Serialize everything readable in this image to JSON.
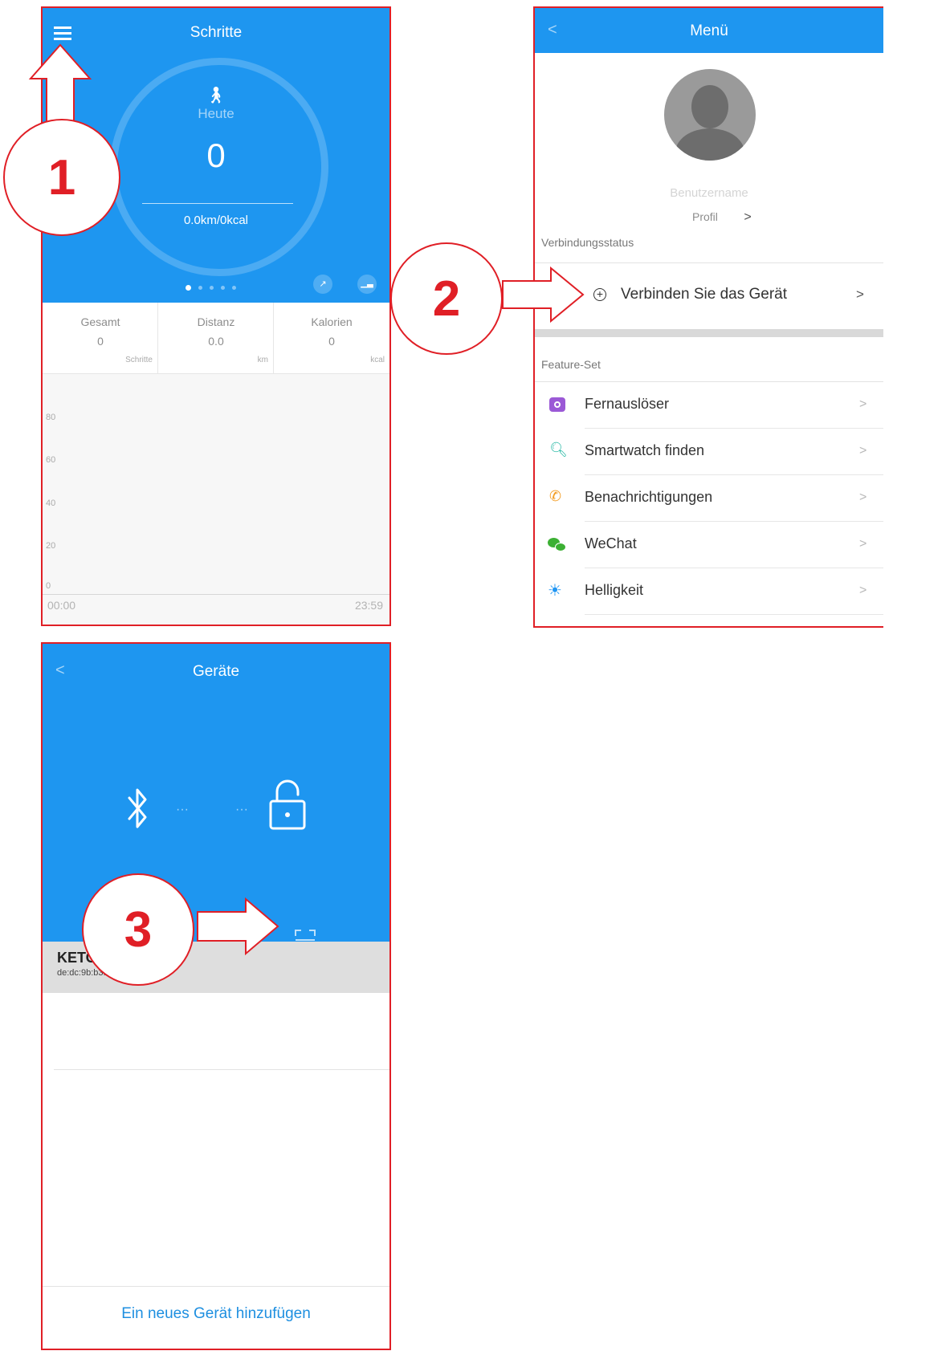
{
  "screen1": {
    "title": "Schritte",
    "today_label": "Heute",
    "steps": "0",
    "dist_kcal": "0.0km/0kcal",
    "stats": [
      {
        "label": "Gesamt",
        "value": "0",
        "unit": "Schritte"
      },
      {
        "label": "Distanz",
        "value": "0.0",
        "unit": "km"
      },
      {
        "label": "Kalorien",
        "value": "0",
        "unit": "kcal"
      }
    ],
    "chart_data": {
      "type": "bar",
      "x": [
        "00:00",
        "23:59"
      ],
      "xtick_labels": [
        "00:00",
        "23:59"
      ],
      "ytick_labels": [
        "80",
        "60",
        "40",
        "20",
        "0"
      ],
      "ylim": [
        0,
        80
      ],
      "values": []
    }
  },
  "screen2": {
    "back": "<",
    "title": "Menü",
    "username": "Benutzername",
    "profile": "Profil",
    "profile_chevron": ">",
    "connection_status": "Verbindungsstatus",
    "connect_device": "Verbinden Sie das Gerät",
    "connect_chevron": ">",
    "feature_set": "Feature-Set",
    "features": [
      {
        "label": "Fernauslöser",
        "icon": "camera-icon",
        "color": "#9b59d6"
      },
      {
        "label": "Smartwatch finden",
        "icon": "find-watch-icon",
        "color": "#23b7a3"
      },
      {
        "label": "Benachrichtigungen",
        "icon": "notification-phone-icon",
        "color": "#f39c22"
      },
      {
        "label": "WeChat",
        "icon": "wechat-icon",
        "color": "#3cb034"
      },
      {
        "label": "Helligkeit",
        "icon": "brightness-icon",
        "color": "#2196f3"
      }
    ],
    "feature_chevron": ">"
  },
  "screen3": {
    "back": "<",
    "title": "Geräte",
    "dots_left": "···",
    "dots_right": "···",
    "device_name": "KETO",
    "device_mac": "de:dc:9b:b3:",
    "add_device": "Ein neues Gerät hinzufügen"
  },
  "callouts": {
    "one": "1",
    "two": "2",
    "three": "3"
  },
  "colors": {
    "app_blue": "#1e96f0",
    "callout_red": "#e01f26",
    "link_blue": "#1e8fe0"
  }
}
